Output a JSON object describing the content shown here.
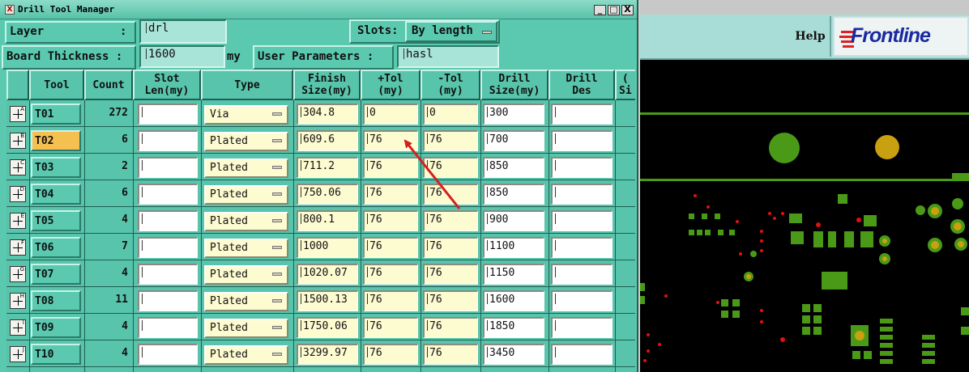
{
  "window": {
    "title": "Drill Tool Manager",
    "controls": [
      "_",
      "□",
      "X"
    ]
  },
  "params": {
    "layer_label": "Layer",
    "layer_colon": ":",
    "layer_value": "drl",
    "slots_label": "Slots:",
    "slots_value": "By length",
    "board_thickness_label": "Board Thickness :",
    "board_thickness_value": "1600",
    "board_thickness_unit": "my",
    "user_params_label": "User Parameters :",
    "user_params_value": "hasl"
  },
  "table": {
    "headers": {
      "tool": "Tool",
      "count": "Count",
      "slot_len": "Slot\nLen(my)",
      "type": "Type",
      "finish": "Finish\nSize(my)",
      "plus_tol": "+Tol\n(my)",
      "minus_tol": "-Tol\n(my)",
      "drill_size": "Drill\nSize(my)",
      "drill_des": "Drill\nDes",
      "extra": "(\nSi"
    },
    "rows": [
      {
        "marker": "A",
        "tool": "T01",
        "count": "272",
        "slot_len": "",
        "type": "Via",
        "finish": "304.8",
        "plus_tol": "0",
        "minus_tol": "0",
        "drill_size": "300",
        "drill_des": "",
        "selected": false
      },
      {
        "marker": "B",
        "tool": "T02",
        "count": "6",
        "slot_len": "",
        "type": "Plated",
        "finish": "609.6",
        "plus_tol": "76",
        "minus_tol": "76",
        "drill_size": "700",
        "drill_des": "",
        "selected": true
      },
      {
        "marker": "C",
        "tool": "T03",
        "count": "2",
        "slot_len": "",
        "type": "Plated",
        "finish": "711.2",
        "plus_tol": "76",
        "minus_tol": "76",
        "drill_size": "850",
        "drill_des": "",
        "selected": false
      },
      {
        "marker": "D",
        "tool": "T04",
        "count": "6",
        "slot_len": "",
        "type": "Plated",
        "finish": "750.06",
        "plus_tol": "76",
        "minus_tol": "76",
        "drill_size": "850",
        "drill_des": "",
        "selected": false
      },
      {
        "marker": "E",
        "tool": "T05",
        "count": "4",
        "slot_len": "",
        "type": "Plated",
        "finish": "800.1",
        "plus_tol": "76",
        "minus_tol": "76",
        "drill_size": "900",
        "drill_des": "",
        "selected": false
      },
      {
        "marker": "F",
        "tool": "T06",
        "count": "7",
        "slot_len": "",
        "type": "Plated",
        "finish": "1000",
        "plus_tol": "76",
        "minus_tol": "76",
        "drill_size": "1100",
        "drill_des": "",
        "selected": false
      },
      {
        "marker": "G",
        "tool": "T07",
        "count": "4",
        "slot_len": "",
        "type": "Plated",
        "finish": "1020.07",
        "plus_tol": "76",
        "minus_tol": "76",
        "drill_size": "1150",
        "drill_des": "",
        "selected": false
      },
      {
        "marker": "H",
        "tool": "T08",
        "count": "11",
        "slot_len": "",
        "type": "Plated",
        "finish": "1500.13",
        "plus_tol": "76",
        "minus_tol": "76",
        "drill_size": "1600",
        "drill_des": "",
        "selected": false
      },
      {
        "marker": "I",
        "tool": "T09",
        "count": "4",
        "slot_len": "",
        "type": "Plated",
        "finish": "1750.06",
        "plus_tol": "76",
        "minus_tol": "76",
        "drill_size": "1850",
        "drill_des": "",
        "selected": false
      },
      {
        "marker": "J",
        "tool": "T10",
        "count": "4",
        "slot_len": "",
        "type": "Plated",
        "finish": "3299.97",
        "plus_tol": "76",
        "minus_tol": "76",
        "drill_size": "3450",
        "drill_des": "",
        "selected": false
      }
    ]
  },
  "right_panel": {
    "help_label": "Help",
    "logo_text": "Frontline"
  },
  "colors": {
    "dialog_bg": "#5ac9b0",
    "selected_tool": "#f6c050",
    "cream_field": "#fdfbd0",
    "annotation_arrow": "#d42020",
    "pcb_background": "#000000",
    "pcb_copper": "#4a9a18",
    "pcb_pad_gold": "#c8a010",
    "pcb_drill_red": "#e01010",
    "logo_blue": "#1a2aa0"
  }
}
